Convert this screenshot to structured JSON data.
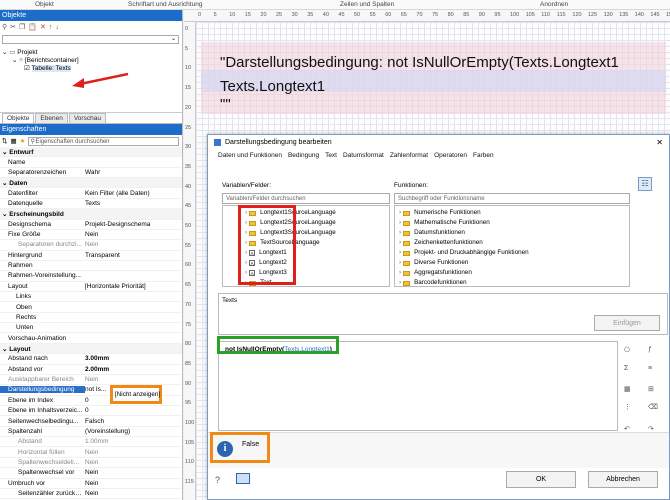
{
  "ribbon": {
    "groups": [
      "Objekt",
      "Schriftart und Ausrichtung",
      "Zeilen und Spalten",
      "Anordnen"
    ]
  },
  "objects_panel": {
    "title": "Objekte",
    "tree": [
      "Projekt",
      "[Berichtscontainer]",
      "Tabelle: Texts"
    ],
    "tabs": [
      "Objekte",
      "Ebenen",
      "Vorschau"
    ]
  },
  "props_panel": {
    "title": "Eigenschaften",
    "search_placeholder": "Eigenschaften durchsuchen",
    "rows": [
      {
        "name": "Entwurf",
        "value": "",
        "section": true
      },
      {
        "name": "Name",
        "value": ""
      },
      {
        "name": "Separatorenzeichen",
        "value": "Wahr"
      },
      {
        "name": "Daten",
        "value": "",
        "section": true
      },
      {
        "name": "Datenfilter",
        "value": "Kein Filter (alle Daten)"
      },
      {
        "name": "Datenquelle",
        "value": "Texts"
      },
      {
        "name": "Erscheinungsbild",
        "value": "",
        "section": true
      },
      {
        "name": "Designschema",
        "value": "Projekt-Designschema"
      },
      {
        "name": "Fixe Größe",
        "value": "Nein"
      },
      {
        "name": "Separatoren durchzi...",
        "value": "Nein"
      },
      {
        "name": "Hintergrund",
        "value": "Transparent"
      },
      {
        "name": "Rahmen",
        "value": ""
      },
      {
        "name": "Rahmen-Voreinstellung...",
        "value": ""
      },
      {
        "name": "Layout",
        "value": "[Horizontale Priorität]"
      },
      {
        "name": "Links",
        "value": ""
      },
      {
        "name": "Oben",
        "value": ""
      },
      {
        "name": "Rechts",
        "value": ""
      },
      {
        "name": "Unten",
        "value": ""
      },
      {
        "name": "Vorschau-Animation",
        "value": ""
      },
      {
        "name": "Layout",
        "value": "",
        "section": true
      },
      {
        "name": "Abstand nach",
        "value": "3.00mm"
      },
      {
        "name": "Abstand vor",
        "value": "2.00mm"
      },
      {
        "name": "Ausklappbarer Bereich",
        "value": "Nein"
      },
      {
        "name": "Darstellungsbedingung",
        "value": "not Is..."
      },
      {
        "name": "Ebene im Index",
        "value": "0"
      },
      {
        "name": "Ebene im Inhaltsverzeic...",
        "value": "0"
      },
      {
        "name": "Seitenwechselbedingu...",
        "value": "Falsch"
      },
      {
        "name": "Spaltenzahl",
        "value": "(Voreinstellung)"
      },
      {
        "name": "Abstand",
        "value": "1.00mm"
      },
      {
        "name": "Horizontal füllen",
        "value": "Nein"
      },
      {
        "name": "Spaltenwechseldeli...",
        "value": "Nein"
      },
      {
        "name": "Spaltenwechsel vor",
        "value": "Nein"
      },
      {
        "name": "Umbruch vor",
        "value": "Nein"
      },
      {
        "name": "Seitenzähler zurücks...",
        "value": "Nein"
      }
    ],
    "condition_highlight": "[Nicht anzeigen]"
  },
  "document": {
    "line1": "\"Darstellungsbedingung: not IsNullOrEmpty(Texts.Longtext1",
    "line2": "Texts.Longtext1",
    "line3": "\"\""
  },
  "dialog": {
    "title": "Darstellungsbedingung bearbeiten",
    "menu": [
      "Daten und Funktionen",
      "Bedingung",
      "Text",
      "Datumsformat",
      "Zahlenformat",
      "Operatoren",
      "Farben"
    ],
    "vars_label": "Variablen/Felder:",
    "vars_placeholder": "Variablen/Felder durchsuchen",
    "vars": [
      "Longtext1SourceLanguage",
      "Longtext2SourceLanguage",
      "Longtext3SourceLanguage",
      "TextSourceLanguage",
      "Longtext1",
      "Longtext2",
      "Longtext3",
      "Text"
    ],
    "funcs_label": "Funktionen:",
    "funcs_placeholder": "Suchbegriff oder Funktionsname",
    "funcs": [
      "Numerische Funktionen",
      "Mathematische Funktionen",
      "Datumsfunktionen",
      "Zeichenkettenfunktionen",
      "Projekt- und Druckabhängige Funktionen",
      "Diverse Funktionen",
      "Aggregatsfunktionen",
      "Barcodefunktionen"
    ],
    "info_text": "Texts",
    "insert_button": "Einfügen",
    "expr_func": "not IsNullOrEmpty(",
    "expr_field": "Texts.Longtext1",
    "expr_end": ")",
    "result": "False",
    "ok": "OK",
    "cancel": "Abbrechen"
  }
}
